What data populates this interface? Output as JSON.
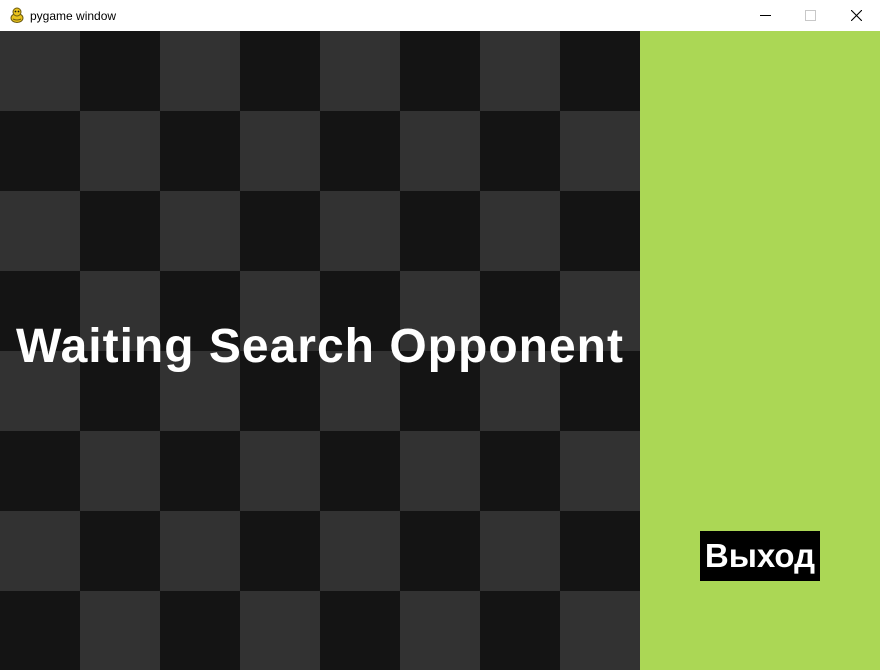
{
  "window": {
    "title": "pygame window",
    "icon": "pygame-snake-icon",
    "controls": [
      "minimize-icon",
      "maximize-icon",
      "close-icon"
    ]
  },
  "board": {
    "rows": 8,
    "cols": 8,
    "dark_color": "#141414",
    "light_color": "#323232"
  },
  "status": {
    "text": "Waiting Search Opponent",
    "color": "#ffffff"
  },
  "sidebar": {
    "background": "#abd755",
    "exit_label": "Выход"
  }
}
